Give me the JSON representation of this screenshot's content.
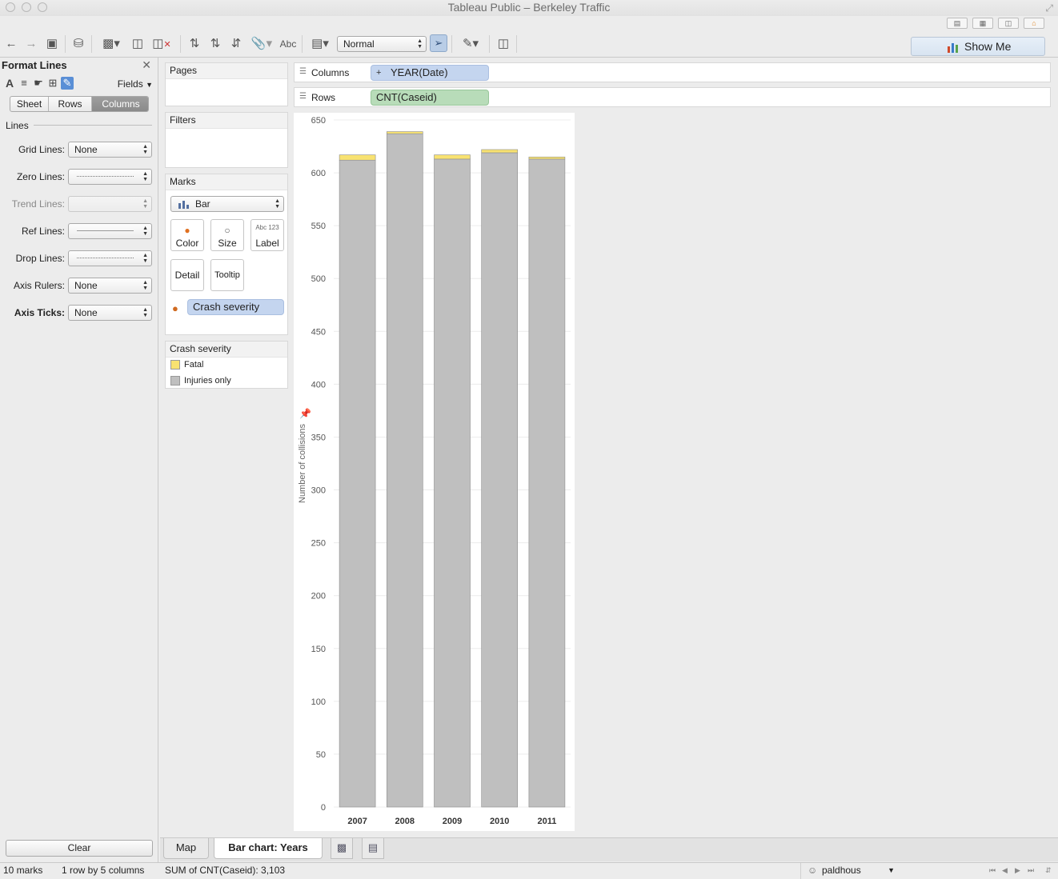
{
  "window": {
    "title": "Tableau Public – Berkeley Traffic"
  },
  "toolbar": {
    "fit_value": "Normal",
    "show_me_label": "Show Me",
    "icons": [
      "back-icon",
      "forward-icon",
      "save-icon",
      "datasource-icon",
      "new-worksheet-icon",
      "duplicate-icon",
      "clear-sheet-icon",
      "swap-icon",
      "sort-ascending-icon",
      "sort-descending-icon",
      "group-icon",
      "show-labels-icon",
      "presentation-icon",
      "pin-icon",
      "highlight-icon",
      "present-icon"
    ],
    "labels_text": "Abc"
  },
  "format_panel": {
    "title": "Format Lines",
    "fields_label": "Fields",
    "tabs": [
      "Sheet",
      "Rows",
      "Columns"
    ],
    "active_tab": "Columns",
    "section": "Lines",
    "rows": [
      {
        "label": "Grid Lines:",
        "value": "None",
        "style": "text",
        "bold": false,
        "disabled": false
      },
      {
        "label": "Zero Lines:",
        "value": "",
        "style": "dotted",
        "bold": false,
        "disabled": false
      },
      {
        "label": "Trend Lines:",
        "value": "",
        "style": "empty",
        "bold": false,
        "disabled": true
      },
      {
        "label": "Ref Lines:",
        "value": "",
        "style": "solid",
        "bold": false,
        "disabled": false
      },
      {
        "label": "Drop Lines:",
        "value": "",
        "style": "dotted",
        "bold": false,
        "disabled": false
      },
      {
        "label": "Axis Rulers:",
        "value": "None",
        "style": "text",
        "bold": false,
        "disabled": false
      },
      {
        "label": "Axis Ticks:",
        "value": "None",
        "style": "text",
        "bold": true,
        "disabled": false
      }
    ],
    "clear_label": "Clear"
  },
  "cards": {
    "pages": "Pages",
    "filters": "Filters",
    "marks": {
      "title": "Marks",
      "type": "Bar",
      "buttons": {
        "color": "Color",
        "size": "Size",
        "label": "Label",
        "label_glyph": "Abc 123",
        "detail": "Detail",
        "tooltip": "Tooltip"
      },
      "color_field": "Crash severity"
    },
    "legend": {
      "title": "Crash severity",
      "items": [
        {
          "name": "Fatal",
          "color": "#f8e271"
        },
        {
          "name": "Injuries only",
          "color": "#bfbfbf"
        }
      ]
    }
  },
  "shelves": {
    "columns_label": "Columns",
    "columns_pill": "YEAR(Date)",
    "columns_pill_expand": "+",
    "rows_label": "Rows",
    "rows_pill": "CNT(Caseid)"
  },
  "chart_data": {
    "type": "bar",
    "stacked": true,
    "categories": [
      "2007",
      "2008",
      "2009",
      "2010",
      "2011"
    ],
    "series": [
      {
        "name": "Injuries only",
        "values": [
          612,
          637,
          613,
          619,
          613
        ],
        "color": "#bfbfbf"
      },
      {
        "name": "Fatal",
        "values": [
          5,
          2,
          4,
          3,
          2
        ],
        "color": "#f8e271"
      }
    ],
    "ylabel": "Number of collisions",
    "xlabel": "",
    "ylim": [
      0,
      650
    ],
    "yticks": [
      0,
      50,
      100,
      150,
      200,
      250,
      300,
      350,
      400,
      450,
      500,
      550,
      600,
      650
    ],
    "grid": true,
    "legend": "side-card"
  },
  "sheet_tabs": {
    "tabs": [
      "Map",
      "Bar chart: Years"
    ],
    "active": "Bar chart: Years",
    "icons": [
      "new-worksheet-tab-icon",
      "new-dashboard-tab-icon"
    ]
  },
  "status": {
    "marks": "10 marks",
    "dims": "1 row by 5 columns",
    "sum": "SUM of CNT(Caseid): 3,103",
    "user": "paldhous"
  }
}
